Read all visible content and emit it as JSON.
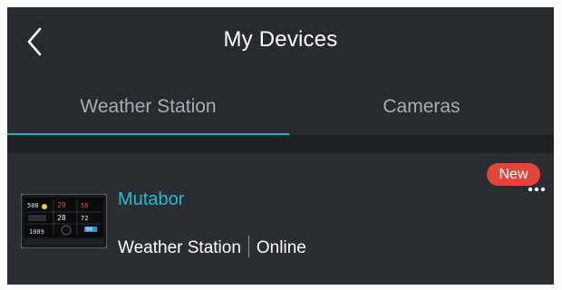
{
  "header": {
    "title": "My Devices",
    "back_icon": "chevron-left-icon"
  },
  "tabs": [
    {
      "label": "Weather Station",
      "active": true
    },
    {
      "label": "Cameras",
      "active": false
    }
  ],
  "colors": {
    "background": "#262a2f",
    "accent": "#1fb2c9",
    "device_name": "#2ab8cf",
    "badge": "#e2463a",
    "tab_text": "#a9adb3"
  },
  "device": {
    "name": "Mutabor",
    "type": "Weather Station",
    "status": "Online",
    "badge": "New",
    "thumbnail_icon": "weather-station-display-icon",
    "more_icon": "more-horizontal-icon",
    "display": {
      "top_left": "508",
      "top_mid": "29",
      "top_right": "58",
      "mid_a": "28",
      "mid_b": "72",
      "bottom": "1089",
      "bottom_right": "00"
    }
  }
}
